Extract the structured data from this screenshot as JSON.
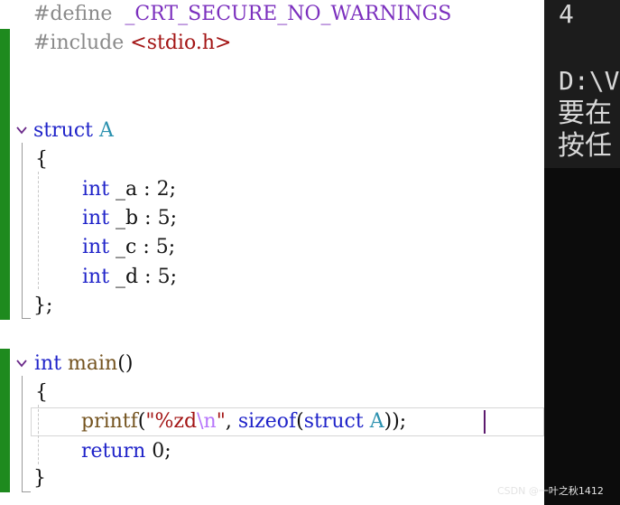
{
  "editor": {
    "accent_green": "#1e8a1e",
    "lines": {
      "define": {
        "directive": "#define",
        "macro": "_CRT_SECURE_NO_WARNINGS"
      },
      "include": {
        "directive": "#include",
        "header": "<stdio.h>"
      },
      "struct_decl": {
        "keyword": "struct",
        "name": "A"
      },
      "struct_open": "{",
      "fields": [
        {
          "type": "int",
          "name": "_a",
          "colon": ":",
          "width": "2",
          "semi": ";"
        },
        {
          "type": "int",
          "name": "_b",
          "colon": ":",
          "width": "5",
          "semi": ";"
        },
        {
          "type": "int",
          "name": "_c",
          "colon": ":",
          "width": "5",
          "semi": ";"
        },
        {
          "type": "int",
          "name": "_d",
          "colon": ":",
          "width": "5",
          "semi": ";"
        }
      ],
      "struct_close": "};",
      "main_decl": {
        "type": "int",
        "name": "main",
        "parens": "()"
      },
      "main_open": "{",
      "printf_line": {
        "fn": "printf",
        "open": "(",
        "str_open": "\"%zd",
        "escape": "\\n",
        "str_close": "\"",
        "comma": ", ",
        "sizeof": "sizeof",
        "paren2": "(",
        "struct_kw": "struct",
        "struct_name": "A",
        "close": "));"
      },
      "return_line": {
        "keyword": "return",
        "value": "0",
        "semi": ";"
      },
      "main_close": "}"
    }
  },
  "console": {
    "lines": [
      "4",
      "",
      "D:\\V",
      "要在",
      "按任"
    ]
  },
  "watermark": "CSDN @一叶之秋1412"
}
